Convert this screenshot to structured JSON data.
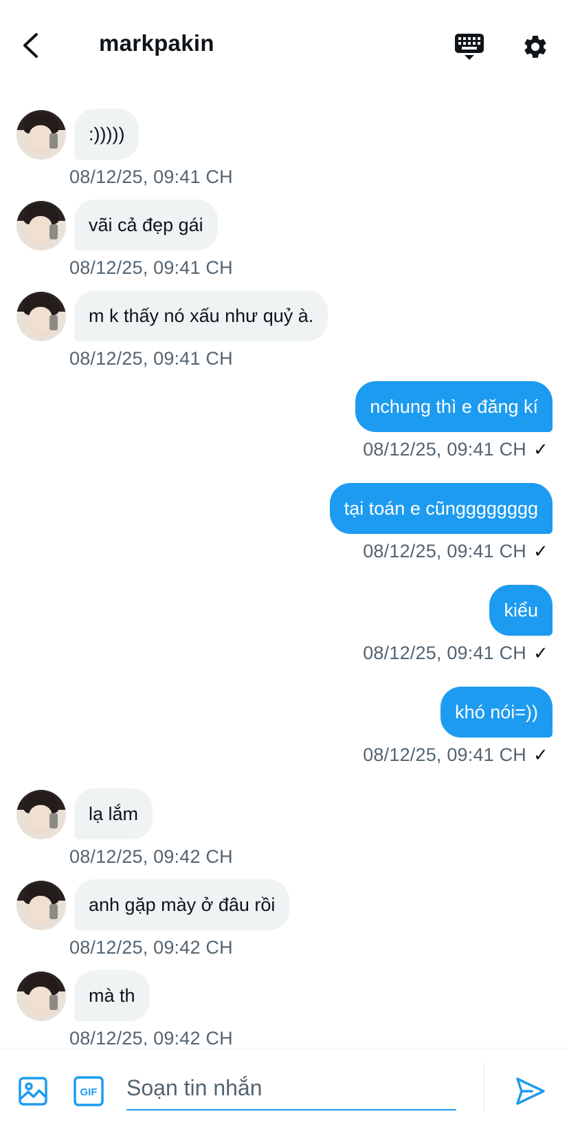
{
  "header": {
    "title": "markpakin",
    "back_icon": "chevron-left-icon",
    "keyboard_icon": "keyboard-icon",
    "settings_icon": "gear-icon"
  },
  "messages": [
    {
      "direction": "in",
      "text": ":)))))",
      "timestamp": "08/12/25, 09:41 CH"
    },
    {
      "direction": "in",
      "text": "vãi cả đẹp gái",
      "timestamp": "08/12/25, 09:41 CH"
    },
    {
      "direction": "in",
      "text": "m k thấy nó xấu như quỷ à.",
      "timestamp": "08/12/25, 09:41 CH"
    },
    {
      "direction": "out",
      "text": "nchung thì e đăng kí",
      "timestamp": "08/12/25, 09:41 CH",
      "status": "✓"
    },
    {
      "direction": "out",
      "text": "tại toán e cũngggggggg",
      "timestamp": "08/12/25, 09:41 CH",
      "status": "✓"
    },
    {
      "direction": "out",
      "text": "kiểu",
      "timestamp": "08/12/25, 09:41 CH",
      "status": "✓"
    },
    {
      "direction": "out",
      "text": "khó nói=))",
      "timestamp": "08/12/25, 09:41 CH",
      "status": "✓"
    },
    {
      "direction": "in",
      "text": "lạ lắm",
      "timestamp": "08/12/25, 09:42 CH"
    },
    {
      "direction": "in",
      "text": "anh gặp mày ở đâu rồi",
      "timestamp": "08/12/25, 09:42 CH"
    },
    {
      "direction": "in",
      "text": "mà th",
      "timestamp": "08/12/25, 09:42 CH"
    }
  ],
  "composer": {
    "placeholder": "Soạn tin nhắn",
    "image_icon": "image-icon",
    "gif_label": "GIF",
    "send_icon": "send-icon"
  },
  "colors": {
    "accent": "#1d9bf0",
    "incoming_bubble": "#eff3f4",
    "timestamp": "#536471",
    "text": "#0f1419"
  }
}
